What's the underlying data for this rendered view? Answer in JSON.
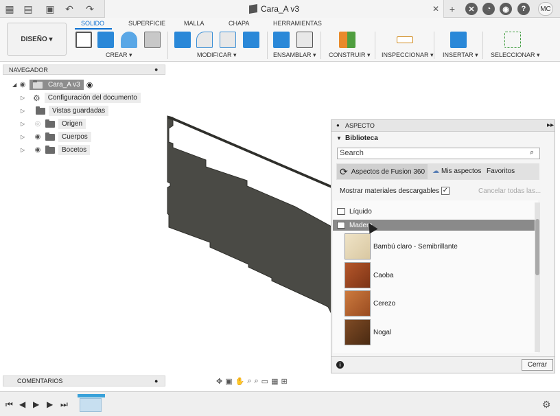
{
  "app": {
    "document_title": "Cara_A v3",
    "user_initials": "MC"
  },
  "toolbar": {
    "workspace_label": "DISEÑO ▾",
    "tabs": [
      "SOLIDO",
      "SUPERFICIE",
      "MALLA",
      "CHAPA",
      "HERRAMIENTAS"
    ],
    "active_tab": "SOLIDO",
    "groups": [
      "CREAR ▾",
      "MODIFICAR ▾",
      "ENSAMBLAR ▾",
      "CONSTRUIR ▾",
      "INSPECCIONAR ▾",
      "INSERTAR ▾",
      "SELECCIONAR ▾"
    ]
  },
  "navigator": {
    "title": "NAVEGADOR",
    "root": "Cara_A v3",
    "items": [
      "Configuración del documento",
      "Vistas guardadas",
      "Origen",
      "Cuerpos",
      "Bocetos"
    ]
  },
  "aspect_panel": {
    "title": "ASPECTO",
    "library_title": "Biblioteca",
    "search_placeholder": "Search",
    "tabs": [
      "Aspectos de Fusion 360",
      "Mis aspectos",
      "Favoritos"
    ],
    "show_downloadable_label": "Mostrar materiales descargables",
    "show_downloadable_checked": true,
    "cancel_all_label": "Cancelar todas las...",
    "categories": [
      "Líquido",
      "Madera"
    ],
    "materials": [
      {
        "name": "Bambú claro - Semibrillante",
        "color": "#e6d7b5"
      },
      {
        "name": "Caoba",
        "color": "#9d4b24"
      },
      {
        "name": "Cerezo",
        "color": "#b5632f"
      },
      {
        "name": "Nogal",
        "color": "#6b3d1c"
      }
    ],
    "close_label": "Cerrar"
  },
  "comments": {
    "title": "COMENTARIOS"
  },
  "colors": {
    "accent": "#0b6fd1",
    "panel_bg": "#f5f5f5",
    "model_color": "#4a4a45"
  }
}
